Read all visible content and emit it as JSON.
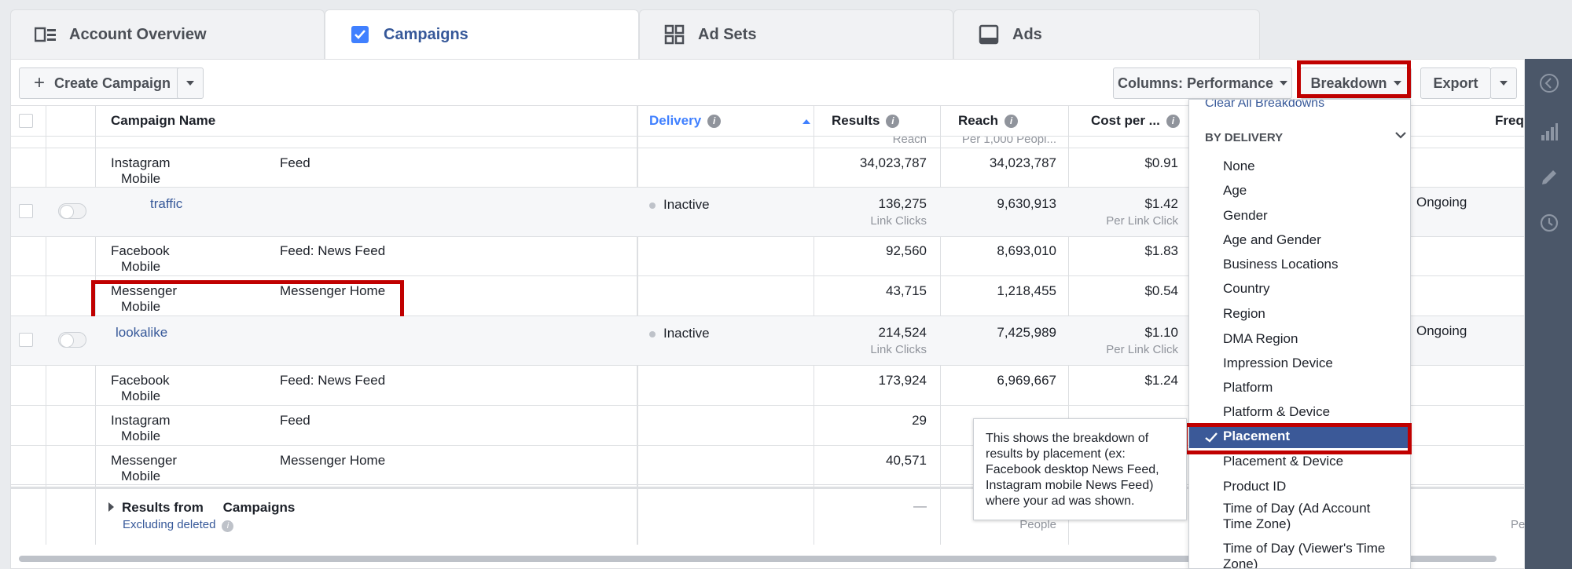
{
  "tabs": [
    {
      "label": "Account Overview",
      "icon": "account-overview-icon"
    },
    {
      "label": "Campaigns",
      "icon": "checkbox-icon"
    },
    {
      "label": "Ad Sets",
      "icon": "grid-icon"
    },
    {
      "label": "Ads",
      "icon": "ad-icon"
    }
  ],
  "toolbar": {
    "create_label": "Create Campaign",
    "columns_label": "Columns: Performance",
    "breakdown_label": "Breakdown",
    "export_label": "Export"
  },
  "table": {
    "headers": {
      "name": "Campaign Name",
      "delivery": "Delivery",
      "results": "Results",
      "reach": "Reach",
      "cost": "Cost per ...",
      "freq": "Freq"
    },
    "top_partial": {
      "reach_sub": "Reach",
      "cost_sub": "Per 1,000 Peopl..."
    },
    "rows": [
      {
        "platform": "Instagram",
        "device": "Mobile",
        "placement": "Feed",
        "results": "34,023,787",
        "reach": "34,023,787",
        "cost": "$0.91"
      },
      {
        "name": "traffic",
        "delivery": "Inactive",
        "results": "136,275",
        "results_sub": "Link Clicks",
        "reach": "9,630,913",
        "cost": "$1.42",
        "cost_sub": "Per Link Click",
        "right": "Ongoing"
      },
      {
        "platform": "Facebook",
        "device": "Mobile",
        "placement": "Feed: News Feed",
        "results": "92,560",
        "reach": "8,693,010",
        "cost": "$1.83"
      },
      {
        "platform": "Messenger",
        "device": "Mobile",
        "placement": "Messenger Home",
        "results": "43,715",
        "reach": "1,218,455",
        "cost": "$0.54"
      },
      {
        "name": "lookalike",
        "delivery": "Inactive",
        "results": "214,524",
        "results_sub": "Link Clicks",
        "reach": "7,425,989",
        "cost": "$1.10",
        "cost_sub": "Per Link Click",
        "right": "Ongoing"
      },
      {
        "platform": "Facebook",
        "device": "Mobile",
        "placement": "Feed: News Feed",
        "results": "173,924",
        "reach": "6,969,667",
        "cost": "$1.24"
      },
      {
        "platform": "Instagram",
        "device": "Mobile",
        "placement": "Feed",
        "results": "29"
      },
      {
        "platform": "Messenger",
        "device": "Mobile",
        "placement": "Messenger Home",
        "results": "40,571"
      }
    ],
    "footer": {
      "label": "Results from",
      "label2": "Campaigns",
      "excluding": "Excluding deleted",
      "dash": "—",
      "people": "People",
      "pe": "Pe"
    }
  },
  "breakdown_menu": {
    "clear": "Clear All Breakdowns",
    "section": "BY DELIVERY",
    "items": [
      "None",
      "Age",
      "Gender",
      "Age and Gender",
      "Business Locations",
      "Country",
      "Region",
      "DMA Region",
      "Impression Device",
      "Platform",
      "Platform & Device",
      "Placement",
      "Placement & Device",
      "Product ID",
      "Time of Day (Ad Account Time Zone)",
      "Time of Day (Viewer's Time Zone)"
    ],
    "selected": "Placement"
  },
  "tooltip": "This shows the breakdown of results by placement (ex: Facebook desktop News Feed, Instagram mobile News Feed) where your ad was shown.",
  "colors": {
    "accent": "#365899",
    "highlight": "#c00000",
    "selected_bg": "#3b5998"
  }
}
